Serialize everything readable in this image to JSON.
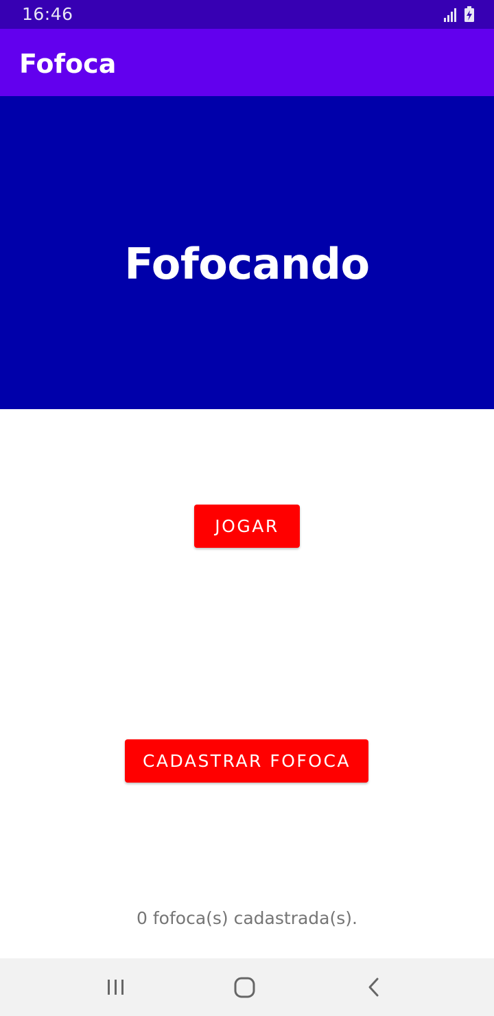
{
  "status_bar": {
    "time": "16:46",
    "icons": [
      "signal-icon",
      "battery-charging-icon"
    ]
  },
  "app_bar": {
    "title": "Fofoca"
  },
  "hero": {
    "title": "Fofocando"
  },
  "buttons": {
    "play_label": "JOGAR",
    "register_label": "CADASTRAR FOFOCA"
  },
  "footer": {
    "count_text": "0 fofoca(s) cadastrada(s)."
  },
  "navigation": {
    "items": [
      "recents-icon",
      "home-icon",
      "back-icon"
    ]
  },
  "colors": {
    "status_bar": "#3700b3",
    "app_bar": "#6200ee",
    "hero_background": "#0000aa",
    "button": "#ff0000",
    "count_text": "#757575",
    "nav_bar": "#f2f2f2"
  }
}
